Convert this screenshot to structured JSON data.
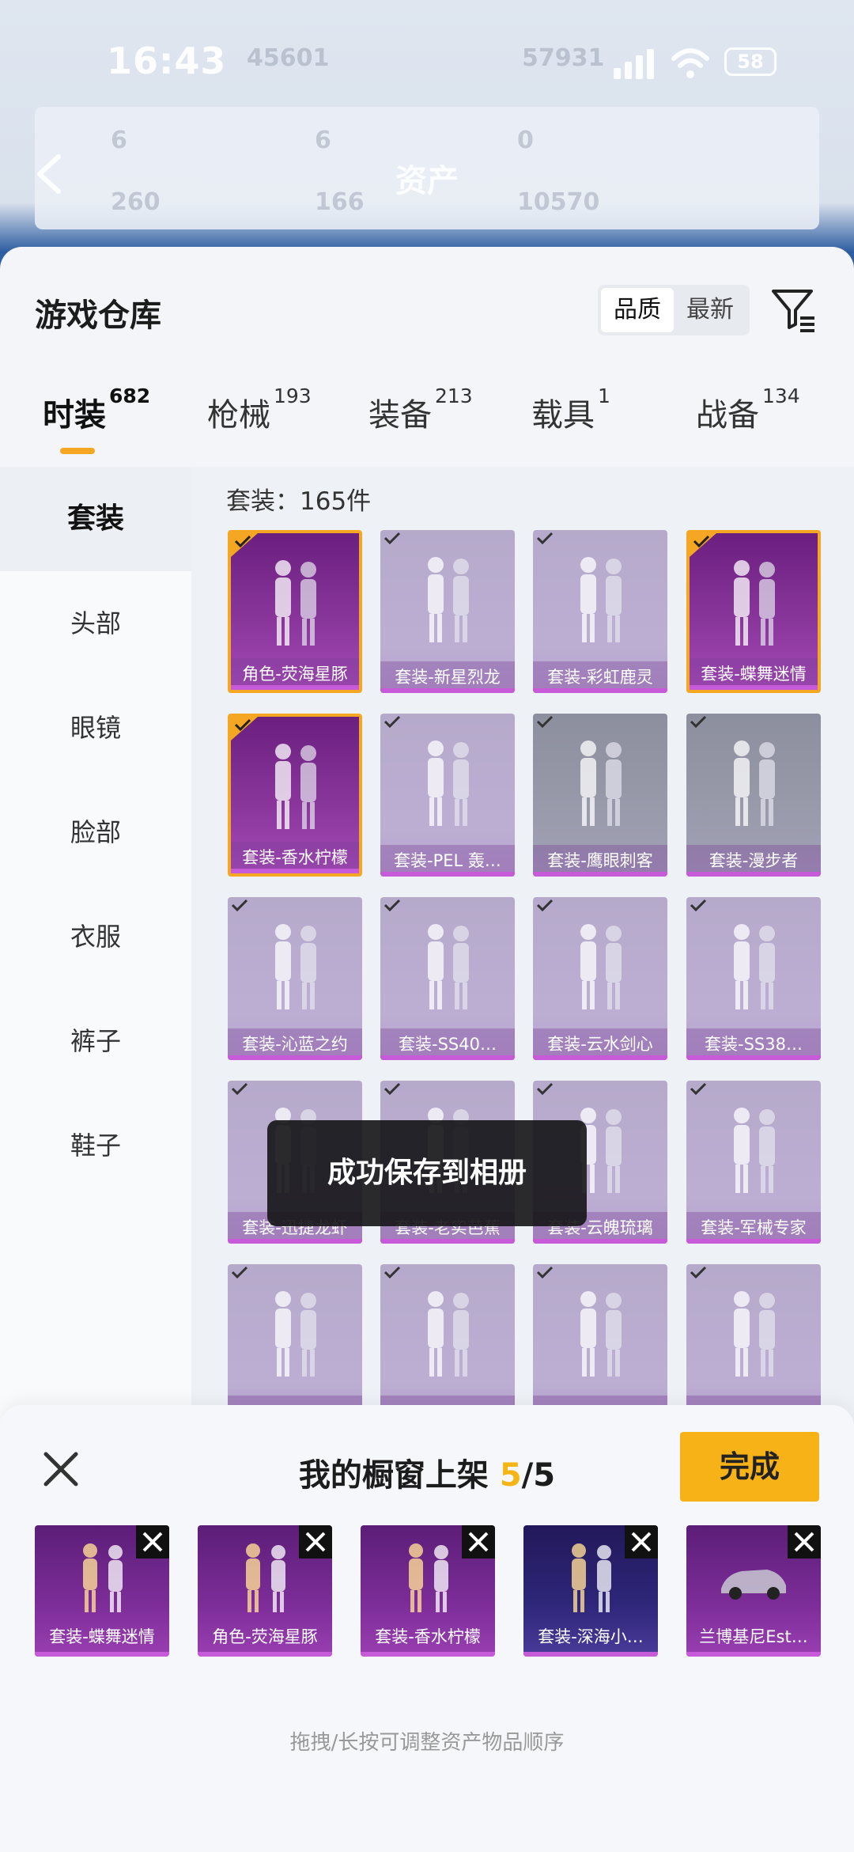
{
  "status_bar": {
    "time": "16:43",
    "battery": "58"
  },
  "background_header": {
    "title": "资产",
    "ghost_numbers": [
      "45601",
      "57931",
      "6",
      "6",
      "0",
      "260",
      "166",
      "10570"
    ]
  },
  "warehouse": {
    "title": "游戏仓库",
    "sort_options": [
      "品质",
      "最新"
    ],
    "active_sort": "品质",
    "tabs": [
      {
        "label": "时装",
        "count": "682"
      },
      {
        "label": "枪械",
        "count": "193"
      },
      {
        "label": "装备",
        "count": "213"
      },
      {
        "label": "载具",
        "count": "1"
      },
      {
        "label": "战备",
        "count": "134"
      }
    ],
    "categories": [
      "套装",
      "头部",
      "眼镜",
      "脸部",
      "衣服",
      "裤子",
      "鞋子"
    ],
    "count_label": "套装：165件",
    "items": [
      {
        "label": "角色-荧海星豚",
        "selected": true
      },
      {
        "label": "套装-新星烈龙",
        "selected": false
      },
      {
        "label": "套装-彩虹鹿灵",
        "selected": false
      },
      {
        "label": "套装-蝶舞迷情",
        "selected": true
      },
      {
        "label": "套装-香水柠檬",
        "selected": true
      },
      {
        "label": "套装-PEL 轰…",
        "selected": false
      },
      {
        "label": "套装-鹰眼刺客",
        "selected": false
      },
      {
        "label": "套装-漫步者",
        "selected": false
      },
      {
        "label": "套装-沁蓝之约",
        "selected": false
      },
      {
        "label": "套装-SS40…",
        "selected": false
      },
      {
        "label": "套装-云水剑心",
        "selected": false
      },
      {
        "label": "套装-SS38…",
        "selected": false
      },
      {
        "label": "套装-迅捷龙虾",
        "selected": false
      },
      {
        "label": "套装-老实芭蕉",
        "selected": false
      },
      {
        "label": "套装-云魄琉璃",
        "selected": false
      },
      {
        "label": "套装-军械专家",
        "selected": false
      },
      {
        "label": "",
        "selected": false
      },
      {
        "label": "",
        "selected": false
      },
      {
        "label": "",
        "selected": false
      },
      {
        "label": "",
        "selected": false
      }
    ],
    "toast": "成功保存到相册"
  },
  "showcase": {
    "title_prefix": "我的橱窗上架 ",
    "count_current": "5",
    "count_total": "/5",
    "done_label": "完成",
    "slots": [
      {
        "label": "套装-蝶舞迷情"
      },
      {
        "label": "角色-荧海星豚"
      },
      {
        "label": "套装-香水柠檬"
      },
      {
        "label": "套装-深海小…"
      },
      {
        "label": "兰博基尼Est…"
      }
    ],
    "hint": "拖拽/长按可调整资产物品顺序"
  }
}
